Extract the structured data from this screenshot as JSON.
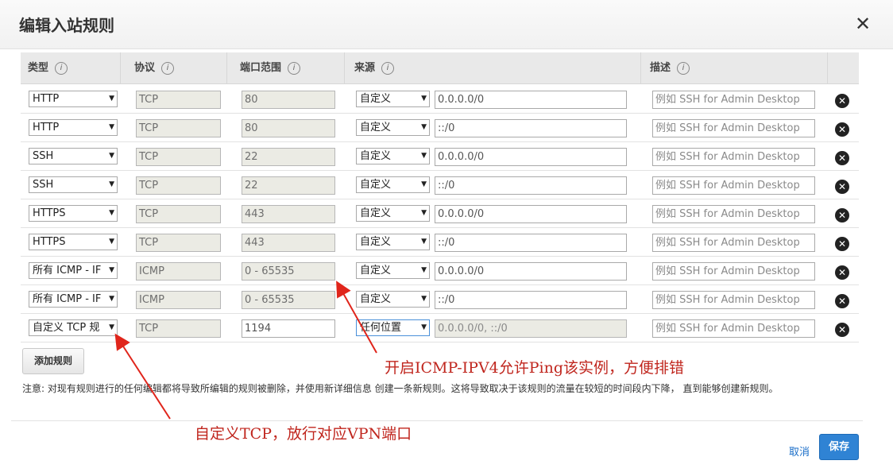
{
  "dialog": {
    "title": "编辑入站规则",
    "close_glyph": "✕"
  },
  "table": {
    "headers": {
      "type": "类型",
      "protocol": "协议",
      "port_range": "端口范围",
      "source": "来源",
      "description": "描述"
    },
    "info_glyph": "i",
    "rows": [
      {
        "type": "HTTP",
        "protocol": "TCP",
        "port": "80",
        "source_mode": "自定义",
        "source_value": "0.0.0.0/0",
        "desc_placeholder": "例如 SSH for Admin Desktop"
      },
      {
        "type": "HTTP",
        "protocol": "TCP",
        "port": "80",
        "source_mode": "自定义",
        "source_value": "::/0",
        "desc_placeholder": "例如 SSH for Admin Desktop"
      },
      {
        "type": "SSH",
        "protocol": "TCP",
        "port": "22",
        "source_mode": "自定义",
        "source_value": "0.0.0.0/0",
        "desc_placeholder": "例如 SSH for Admin Desktop"
      },
      {
        "type": "SSH",
        "protocol": "TCP",
        "port": "22",
        "source_mode": "自定义",
        "source_value": "::/0",
        "desc_placeholder": "例如 SSH for Admin Desktop"
      },
      {
        "type": "HTTPS",
        "protocol": "TCP",
        "port": "443",
        "source_mode": "自定义",
        "source_value": "0.0.0.0/0",
        "desc_placeholder": "例如 SSH for Admin Desktop"
      },
      {
        "type": "HTTPS",
        "protocol": "TCP",
        "port": "443",
        "source_mode": "自定义",
        "source_value": "::/0",
        "desc_placeholder": "例如 SSH for Admin Desktop"
      },
      {
        "type": "所有 ICMP - IF",
        "protocol": "ICMP",
        "port": "0 - 65535",
        "source_mode": "自定义",
        "source_value": "0.0.0.0/0",
        "desc_placeholder": "例如 SSH for Admin Desktop"
      },
      {
        "type": "所有 ICMP - IF",
        "protocol": "ICMP",
        "port": "0 - 65535",
        "source_mode": "自定义",
        "source_value": "::/0",
        "desc_placeholder": "例如 SSH for Admin Desktop"
      },
      {
        "type": "自定义 TCP 规",
        "protocol": "TCP",
        "port": "1194",
        "source_mode": "任何位置",
        "source_value": "0.0.0.0/0, ::/0",
        "desc_placeholder": "例如 SSH for Admin Desktop"
      }
    ],
    "delete_glyph": "✕"
  },
  "actions": {
    "add_rule": "添加规则",
    "cancel": "取消",
    "save": "保存"
  },
  "note": "注意: 对现有规则进行的任何编辑都将导致所编辑的规则被删除，并使用新详细信息 创建一条新规则。这将导致取决于该规则的流量在较短的时间段内下降， 直到能够创建新规则。",
  "annotations": {
    "icmp_note": "开启ICMP-IPV4允许Ping该实例，方便排错",
    "vpn_note": "自定义TCP，放行对应VPN端口"
  },
  "colors": {
    "annotation": "#c0261e",
    "save_button": "#2f83d4",
    "link": "#1a6ec8"
  }
}
